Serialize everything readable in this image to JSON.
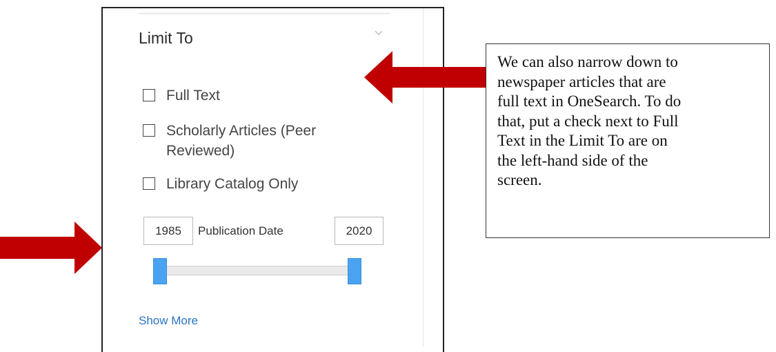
{
  "panel": {
    "heading": "Limit To",
    "collapse_icon": "chevron-down-icon",
    "options": [
      {
        "label_lines": [
          "Full Text"
        ],
        "checked": false
      },
      {
        "label_lines": [
          "Scholarly Articles (Peer",
          "Reviewed)"
        ],
        "checked": false
      },
      {
        "label_lines": [
          "Library Catalog Only"
        ],
        "checked": false
      }
    ],
    "publication_date": {
      "label": "Publication Date",
      "from": "1985",
      "to": "2020",
      "slider_from_fraction": 0.0,
      "slider_to_fraction": 1.0,
      "handle_color": "#4aa3f0"
    },
    "show_more": "Show More"
  },
  "annotation": {
    "text_lines": [
      "We can also narrow down to",
      "newspaper articles that are",
      "full text in OneSearch. To do",
      "that, put a check next to Full",
      "Text in the Limit To are on",
      "the left-hand side of the",
      "screen."
    ],
    "arrow_color": "#c00000"
  }
}
